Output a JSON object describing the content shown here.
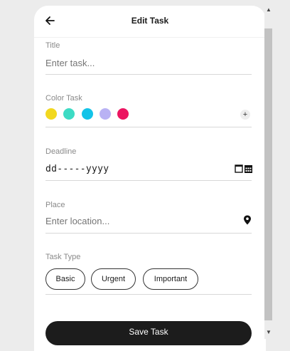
{
  "header": {
    "back_icon": "arrow-left-icon",
    "title": "Edit Task"
  },
  "form": {
    "title": {
      "label": "Title",
      "placeholder": "Enter task..."
    },
    "color_task": {
      "label": "Color Task",
      "colors": [
        "#f2d81f",
        "#3ddbc4",
        "#13c3e8",
        "#b9b2f4",
        "#ec1561"
      ],
      "add_icon": "plus-icon",
      "add_label": "+"
    },
    "deadline": {
      "label": "Deadline",
      "value": "dd-----yyyy",
      "icon": "calendar-icon"
    },
    "place": {
      "label": "Place",
      "placeholder": "Enter location...",
      "icon": "location-pin-icon"
    },
    "task_type": {
      "label": "Task Type",
      "options": [
        "Basic",
        "Urgent",
        "Important"
      ]
    }
  },
  "actions": {
    "save_label": "Save Task"
  },
  "scrollbar": {
    "up_glyph": "▲",
    "down_glyph": "▼"
  }
}
